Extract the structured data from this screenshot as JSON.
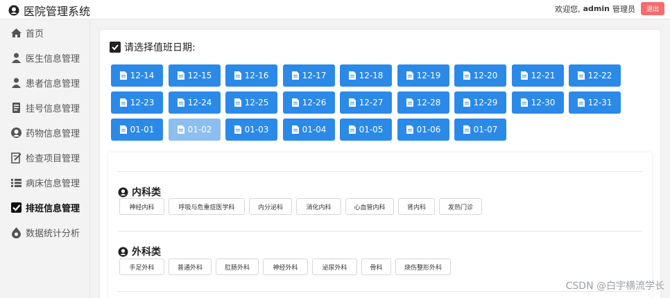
{
  "app": {
    "title": "医院管理系统"
  },
  "user": {
    "welcome": "欢迎您,",
    "name": "admin",
    "role": "管理员",
    "logout": "退出"
  },
  "sidebar": {
    "items": [
      {
        "label": "首页",
        "icon": "home-icon"
      },
      {
        "label": "医生信息管理",
        "icon": "doctor-icon"
      },
      {
        "label": "患者信息管理",
        "icon": "patient-icon"
      },
      {
        "label": "挂号信息管理",
        "icon": "register-icon"
      },
      {
        "label": "药物信息管理",
        "icon": "medicine-icon"
      },
      {
        "label": "检查项目管理",
        "icon": "exam-icon"
      },
      {
        "label": "病床信息管理",
        "icon": "list-icon"
      },
      {
        "label": "排班信息管理",
        "icon": "checkbox-icon",
        "active": true
      },
      {
        "label": "数据统计分析",
        "icon": "stats-icon"
      }
    ]
  },
  "schedule": {
    "heading": "请选择值班日期:",
    "dates": [
      "12-14",
      "12-15",
      "12-16",
      "12-17",
      "12-18",
      "12-19",
      "12-20",
      "12-21",
      "12-22",
      "12-23",
      "12-24",
      "12-25",
      "12-26",
      "12-27",
      "12-28",
      "12-29",
      "12-30",
      "12-31",
      "01-01",
      "01-02",
      "01-03",
      "01-04",
      "01-05",
      "01-06",
      "01-07"
    ],
    "selected": "01-02"
  },
  "departments": [
    {
      "title": "内科类",
      "items": [
        "神经内科",
        "呼吸与危重症医学科",
        "内分泌科",
        "消化内科",
        "心血管内科",
        "肾内科",
        "发热门诊"
      ]
    },
    {
      "title": "外科类",
      "items": [
        "手足外科",
        "普通外科",
        "肛肠外科",
        "神经外科",
        "泌尿外科",
        "骨科",
        "烧伤整形外科"
      ]
    }
  ],
  "watermark": "CSDN @白宇横流学长",
  "colors": {
    "primary": "#2b8ae8",
    "selected": "#8cbef0",
    "danger": "#f56c6c"
  }
}
